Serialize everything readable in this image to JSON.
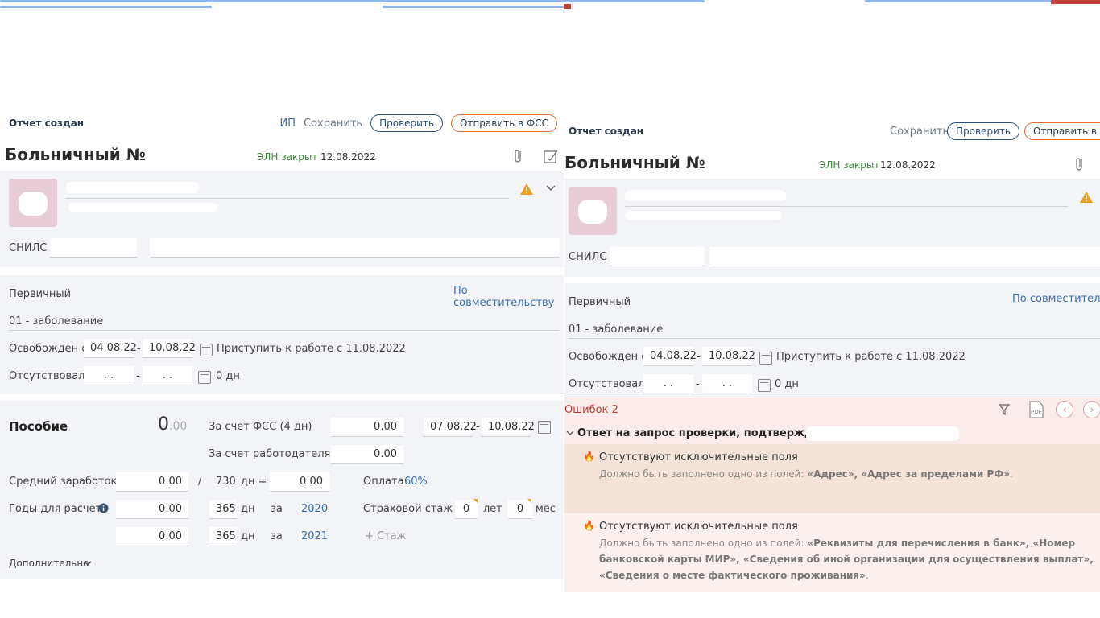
{
  "left": {
    "status": "Отчет создан",
    "ip_label": "ИП",
    "save_label": "Сохранить",
    "check_label": "Проверить",
    "send_label": "Отправить в ФСС",
    "title": "Больничный №",
    "eln_status": "ЭЛН закрыт",
    "eln_date": "12.08.2022",
    "snils_label": "СНИЛС",
    "primary_label": "Первичный",
    "combo_link": "По совместительству",
    "reason": "01 - заболевание",
    "released_label": "Освобожден с",
    "released_from": "04.08.22",
    "released_to": "10.08.22",
    "return_text": "Приступить к работе с 11.08.2022",
    "absent_label": "Отсутствовал",
    "absent_from": " .  . ",
    "absent_to": " .  . ",
    "absent_days": "0 дн",
    "benefit_title": "Пособие",
    "benefit_sum": "0",
    "benefit_dec": ".00",
    "fss_label": "За счет ФСС (4 дн)",
    "fss_value": "0.00",
    "fss_from": "07.08.22",
    "fss_to": "10.08.22",
    "employer_label": "За счет работодателя",
    "employer_value": "0.00",
    "avg_label": "Средний заработок",
    "avg_value": "0.00",
    "divider": "/",
    "avg_days": "730",
    "days_eq": "дн =",
    "avg_result": "0.00",
    "pay_label": "Оплата",
    "pay_value": "60%",
    "years_label": "Годы для расчета",
    "y1_value": "0.00",
    "y1_days": "365",
    "y1_dn": "дн",
    "y1_for": "за",
    "y1_year": "2020",
    "y2_value": "0.00",
    "y2_days": "365",
    "y2_dn": "дн",
    "y2_for": "за",
    "y2_year": "2021",
    "stazh_label": "Страховой стаж",
    "stazh_years": "0",
    "stazh_years_unit": "лет",
    "stazh_months": "0",
    "stazh_months_unit": "мес",
    "add_stazh": "+ Стаж",
    "more_label": "Дополнительно"
  },
  "right": {
    "status": "Отчет создан",
    "save_label": "Сохранить",
    "check_label": "Проверить",
    "send_label": "Отправить в Ф",
    "title": "Больничный №",
    "eln_status": "ЭЛН закрыт",
    "eln_date": "12.08.2022",
    "snils_label": "СНИЛС",
    "primary_label": "Первичный",
    "combo_link": "По совместительс",
    "reason": "01 - заболевание",
    "released_label": "Освобожден с",
    "released_from": "04.08.22",
    "released_to": "10.08.22",
    "return_text": "Приступить к работе с 11.08.2022",
    "absent_label": "Отсутствовал",
    "absent_from": " .  . ",
    "absent_to": " .  . ",
    "absent_days": "0 дн",
    "errors_title": "Ошибок 2",
    "response_title": "Ответ на запрос проверки, подтверждения за",
    "error1_title": "Отсутствуют исключительные поля",
    "error1_desc_prefix": "Должно быть заполнено одно из полей: ",
    "error1_desc_fields": "«Адрес», «Адрес за пределами РФ»",
    "error1_desc_suffix": ".",
    "error2_title": "Отсутствуют исключительные поля",
    "error2_desc_prefix": "Должно быть заполнено одно из полей: ",
    "error2_desc_fields": "«Реквизиты для перечисления в банк», «Номер банковской карты МИР», «Сведения об иной организации для осуществления выплат», «Сведения о месте фактического проживания»",
    "error2_desc_suffix": "."
  },
  "icons": {
    "attach": "paperclip-icon",
    "sign": "sign-document-icon",
    "warning": "warning-icon",
    "chevron": "chevron-down-icon",
    "calendar": "calendar-icon",
    "info": "info-icon",
    "filter": "filter-icon",
    "pdf": "pdf-icon",
    "prev": "chevron-left-icon",
    "next": "chevron-right-icon",
    "fire": "fire-icon"
  },
  "colors": {
    "accent_blue": "#3a6fb0",
    "eln_green": "#3f8a3f",
    "warning": "#e8a020",
    "error_red": "#c0392b",
    "error_bg": "#fbecec",
    "send_border": "#e06a2f"
  }
}
